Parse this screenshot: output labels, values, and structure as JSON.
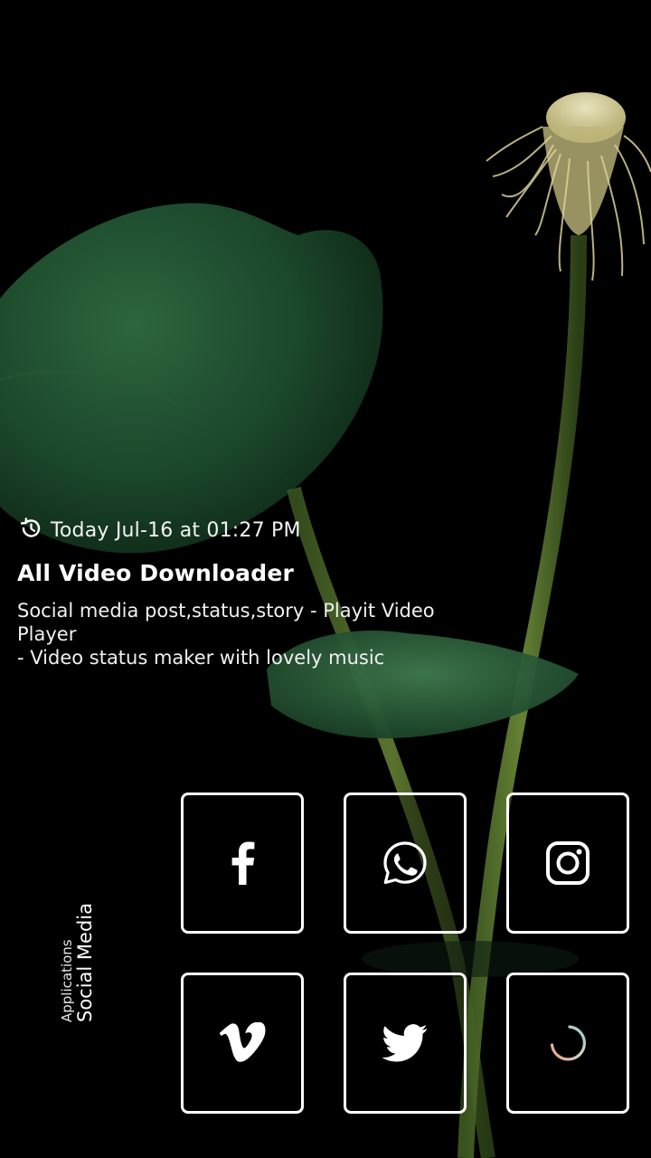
{
  "post": {
    "timestamp": "Today Jul-16 at 01:27 PM",
    "title": "All Video Downloader",
    "description_lines": [
      "Social media post,status,story - Playit Video",
      "Player",
      "- Video status maker with lovely music"
    ]
  },
  "category": {
    "label_small": "Applications",
    "label_big": "Social Media"
  },
  "tiles": [
    {
      "icon": "facebook-icon"
    },
    {
      "icon": "whatsapp-icon"
    },
    {
      "icon": "instagram-icon"
    },
    {
      "icon": "vimeo-icon"
    },
    {
      "icon": "twitter-icon"
    },
    {
      "icon": "loading-spinner-icon"
    }
  ],
  "colors": {
    "background": "#000000",
    "text": "#ffffff",
    "tile_border": "#ffffff",
    "spinner_start": "#e8a27a",
    "spinner_mid": "#d9d3c4",
    "spinner_end": "#8fd0c8"
  }
}
